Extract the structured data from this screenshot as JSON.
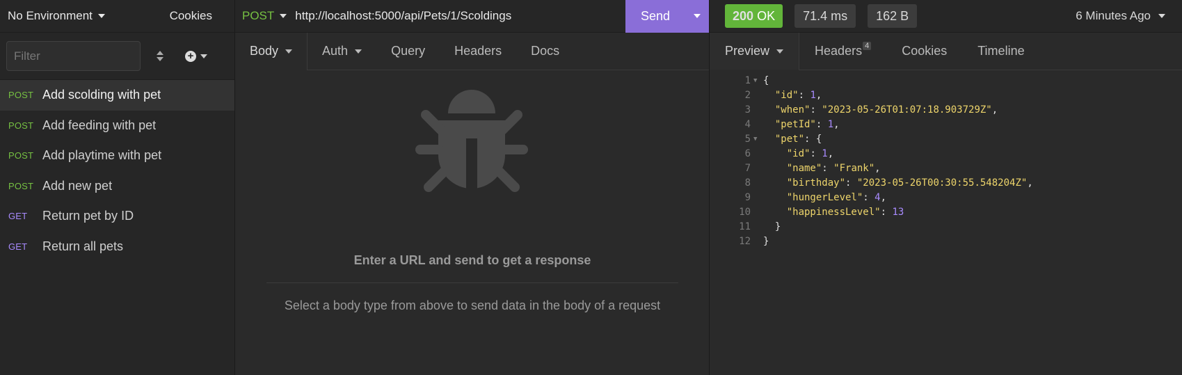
{
  "sidebar": {
    "environment_label": "No Environment",
    "cookies_label": "Cookies",
    "filter_placeholder": "Filter",
    "requests": [
      {
        "method": "POST",
        "name": "Add scolding with pet",
        "active": true
      },
      {
        "method": "POST",
        "name": "Add feeding with pet",
        "active": false
      },
      {
        "method": "POST",
        "name": "Add playtime with pet",
        "active": false
      },
      {
        "method": "POST",
        "name": "Add new pet",
        "active": false
      },
      {
        "method": "GET",
        "name": "Return pet by ID",
        "active": false
      },
      {
        "method": "GET",
        "name": "Return all pets",
        "active": false
      }
    ]
  },
  "request": {
    "method": "POST",
    "url": "http://localhost:5000/api/Pets/1/Scoldings",
    "send_label": "Send",
    "tabs": [
      "Body",
      "Auth",
      "Query",
      "Headers",
      "Docs"
    ],
    "empty_title": "Enter a URL and send to get a response",
    "empty_hint": "Select a body type from above to send data in the body of a request"
  },
  "response": {
    "status_code": "200",
    "status_text": "OK",
    "time": "71.4 ms",
    "size": "162 B",
    "time_ago": "6 Minutes Ago",
    "tabs": {
      "preview": "Preview",
      "headers": "Headers",
      "headers_count": "4",
      "cookies": "Cookies",
      "timeline": "Timeline"
    },
    "code_lines": [
      {
        "n": "1",
        "fold": true,
        "tokens": [
          [
            "p",
            "{"
          ]
        ]
      },
      {
        "n": "2",
        "fold": false,
        "tokens": [
          [
            "p",
            "  "
          ],
          [
            "k",
            "\"id\""
          ],
          [
            "p",
            ": "
          ],
          [
            "n",
            "1"
          ],
          [
            "p",
            ","
          ]
        ]
      },
      {
        "n": "3",
        "fold": false,
        "tokens": [
          [
            "p",
            "  "
          ],
          [
            "k",
            "\"when\""
          ],
          [
            "p",
            ": "
          ],
          [
            "s",
            "\"2023-05-26T01:07:18.903729Z\""
          ],
          [
            "p",
            ","
          ]
        ]
      },
      {
        "n": "4",
        "fold": false,
        "tokens": [
          [
            "p",
            "  "
          ],
          [
            "k",
            "\"petId\""
          ],
          [
            "p",
            ": "
          ],
          [
            "n",
            "1"
          ],
          [
            "p",
            ","
          ]
        ]
      },
      {
        "n": "5",
        "fold": true,
        "tokens": [
          [
            "p",
            "  "
          ],
          [
            "k",
            "\"pet\""
          ],
          [
            "p",
            ": {"
          ]
        ]
      },
      {
        "n": "6",
        "fold": false,
        "tokens": [
          [
            "p",
            "    "
          ],
          [
            "k",
            "\"id\""
          ],
          [
            "p",
            ": "
          ],
          [
            "n",
            "1"
          ],
          [
            "p",
            ","
          ]
        ]
      },
      {
        "n": "7",
        "fold": false,
        "tokens": [
          [
            "p",
            "    "
          ],
          [
            "k",
            "\"name\""
          ],
          [
            "p",
            ": "
          ],
          [
            "s",
            "\"Frank\""
          ],
          [
            "p",
            ","
          ]
        ]
      },
      {
        "n": "8",
        "fold": false,
        "tokens": [
          [
            "p",
            "    "
          ],
          [
            "k",
            "\"birthday\""
          ],
          [
            "p",
            ": "
          ],
          [
            "s",
            "\"2023-05-26T00:30:55.548204Z\""
          ],
          [
            "p",
            ","
          ]
        ]
      },
      {
        "n": "9",
        "fold": false,
        "tokens": [
          [
            "p",
            "    "
          ],
          [
            "k",
            "\"hungerLevel\""
          ],
          [
            "p",
            ": "
          ],
          [
            "n",
            "4"
          ],
          [
            "p",
            ","
          ]
        ]
      },
      {
        "n": "10",
        "fold": false,
        "tokens": [
          [
            "p",
            "    "
          ],
          [
            "k",
            "\"happinessLevel\""
          ],
          [
            "p",
            ": "
          ],
          [
            "n",
            "13"
          ]
        ]
      },
      {
        "n": "11",
        "fold": false,
        "tokens": [
          [
            "p",
            "  }"
          ]
        ]
      },
      {
        "n": "12",
        "fold": false,
        "tokens": [
          [
            "p",
            "}"
          ]
        ]
      }
    ]
  },
  "colors": {
    "post_method": "#76c142",
    "get_method": "#a98bff",
    "send_button": "#8a6ed8",
    "status_ok": "#62b53a",
    "json_string": "#eed56b",
    "json_number": "#a98bff"
  },
  "icons": {
    "environment_dropdown": "chevron-down-icon",
    "sort": "sort-icon",
    "new_request": "plus-circle-icon",
    "empty_state": "bug-icon"
  }
}
